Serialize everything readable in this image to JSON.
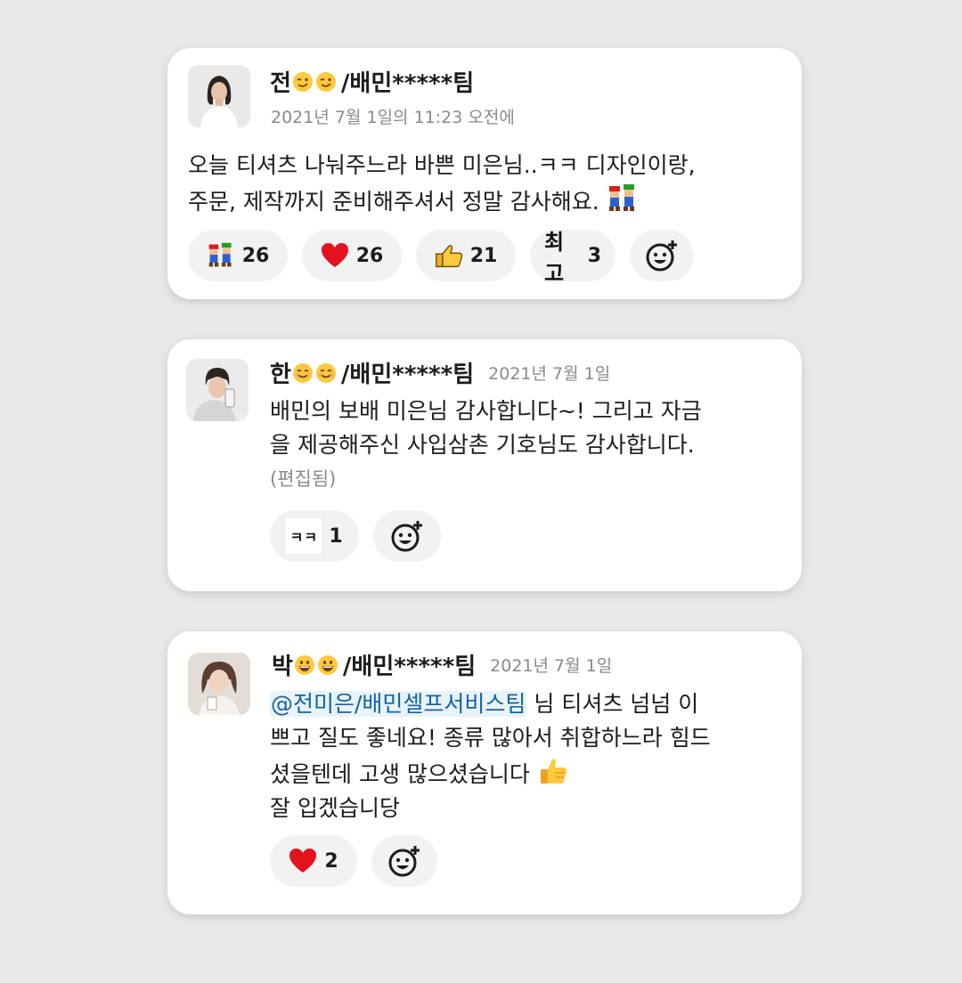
{
  "messages": [
    {
      "author_prefix": "전",
      "author_suffix": "/배민*****팀",
      "author_emoji": [
        "wink-face",
        "wink-face"
      ],
      "timestamp": "2021년 7월 1일의 11:23 오전에",
      "text_lines": [
        "오늘 티셔츠 나눠주느라 바쁜 미은님..ㅋㅋ 디자인이랑,",
        "주문, 제작까지 준비해주셔서 정말 감사해요."
      ],
      "inline_emoji": "mario-luigi",
      "reactions": [
        {
          "icon": "mario-luigi",
          "count": "26"
        },
        {
          "icon": "red-heart",
          "count": "26"
        },
        {
          "icon": "thumbs-up-custom",
          "count": "21"
        },
        {
          "icon": "choego-text",
          "label": "최고",
          "count": "3"
        },
        {
          "icon": "add-reaction"
        }
      ]
    },
    {
      "author_prefix": "한",
      "author_suffix": "/배민*****팀",
      "author_emoji": [
        "smile-face",
        "smile-face"
      ],
      "timestamp": "2021년 7월 1일",
      "text_lines": [
        "배민의 보배 미은님 감사합니다~! 그리고 자금",
        "을 제공해주신 사입삼촌 기호님도 감사합니다."
      ],
      "edited": "(편집됨)",
      "reactions": [
        {
          "icon": "kk-text",
          "label": "ㅋㅋ",
          "count": "1"
        },
        {
          "icon": "add-reaction"
        }
      ]
    },
    {
      "author_prefix": "박",
      "author_suffix": "/배민*****팀",
      "author_emoji": [
        "grin-face",
        "grin-face"
      ],
      "timestamp": "2021년 7월 1일",
      "mention": "@전미은/배민셀프서비스팀",
      "text_line1_after_mention": " 님 티셔츠 넘넘 이",
      "text_lines": [
        "쁘고 질도 좋네요! 종류 많아서 취합하느라 힘드",
        "셨을텐데 고생 많으셨습니다",
        "잘 입겠습니당"
      ],
      "inline_emoji": "thumbs-up",
      "reactions": [
        {
          "icon": "red-heart",
          "count": "2"
        },
        {
          "icon": "add-reaction"
        }
      ]
    }
  ],
  "colors": {
    "background": "#e8e8e8",
    "card": "#ffffff",
    "reaction_pill": "#f2f2f2",
    "mention_bg": "#e8f3fa",
    "mention_text": "#1264a3",
    "timestamp": "#8a8a8a"
  }
}
